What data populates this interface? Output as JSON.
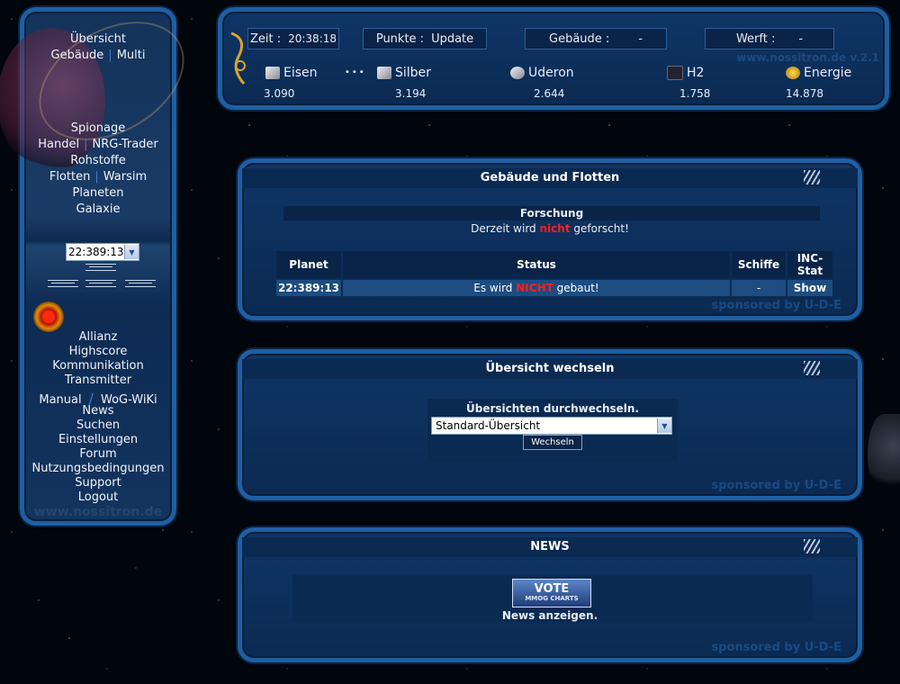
{
  "nav": {
    "top": [
      "Übersicht"
    ],
    "row2": [
      "Gebäude",
      "Multi"
    ],
    "spionage": "Spionage",
    "handel_row": [
      "Handel",
      "NRG-Trader"
    ],
    "rohstoffe": "Rohstoffe",
    "flotten_row": [
      "Flotten",
      "Warsim"
    ],
    "planeten": "Planeten",
    "galaxie": "Galaxie",
    "planet_select": "22:389:13",
    "bottom": [
      "Allianz",
      "Highscore",
      "Kommunikation",
      "Transmitter"
    ],
    "manual_row": [
      "Manual",
      "WoG-WiKi"
    ],
    "bottom2": [
      "News",
      "Suchen",
      "Einstellungen",
      "Forum",
      "Nutzungsbedingungen",
      "Support",
      "Logout"
    ],
    "footer": "www.nossitron.de"
  },
  "topbar": {
    "zeit_label": "Zeit :",
    "zeit_value": "20:38:18",
    "punkte_label": "Punkte :",
    "punkte_value": "Update",
    "gebaeude_label": "Gebäude :",
    "gebaeude_value": "-",
    "werft_label": "Werft :",
    "werft_value": "-",
    "watermark": "www.nossitron.de v.2.1",
    "resources": [
      {
        "name": "Eisen",
        "value": "3.090",
        "icon": "iron-icon"
      },
      {
        "name": "Silber",
        "value": "3.194",
        "icon": "silver-icon"
      },
      {
        "name": "Uderon",
        "value": "2.644",
        "icon": "uderon-icon"
      },
      {
        "name": "H2",
        "value": "1.758",
        "icon": "h2-icon"
      },
      {
        "name": "Energie",
        "value": "14.878",
        "icon": "energy-icon"
      }
    ]
  },
  "panel1": {
    "title": "Gebäude und Flotten",
    "forschung_label": "Forschung",
    "forschung_pre": "Derzeit wird",
    "forschung_red": "nicht",
    "forschung_post": "geforscht!",
    "columns": [
      "Planet",
      "Status",
      "Schiffe",
      "INC-Stat"
    ],
    "row": {
      "planet": "22:389:13",
      "status_pre": "Es wird",
      "status_red": "NICHT",
      "status_post": "gebaut!",
      "schiffe": "-",
      "inc": "Show"
    },
    "sponsor": "sponsored by U-D-E"
  },
  "panel2": {
    "title": "Übersicht wechseln",
    "subtitle": "Übersichten durchwechseln.",
    "select_value": "Standard-Übersicht",
    "button": "Wechseln",
    "sponsor": "sponsored by U-D-E"
  },
  "panel3": {
    "title": "NEWS",
    "vote_big": "VOTE",
    "vote_small": "MMOG CHARTS",
    "link": "News anzeigen.",
    "sponsor": "sponsored by U-D-E"
  },
  "colors": {
    "accent": "#1e5fa3",
    "red": "#ff1e1e",
    "panel": "#0f3566"
  }
}
